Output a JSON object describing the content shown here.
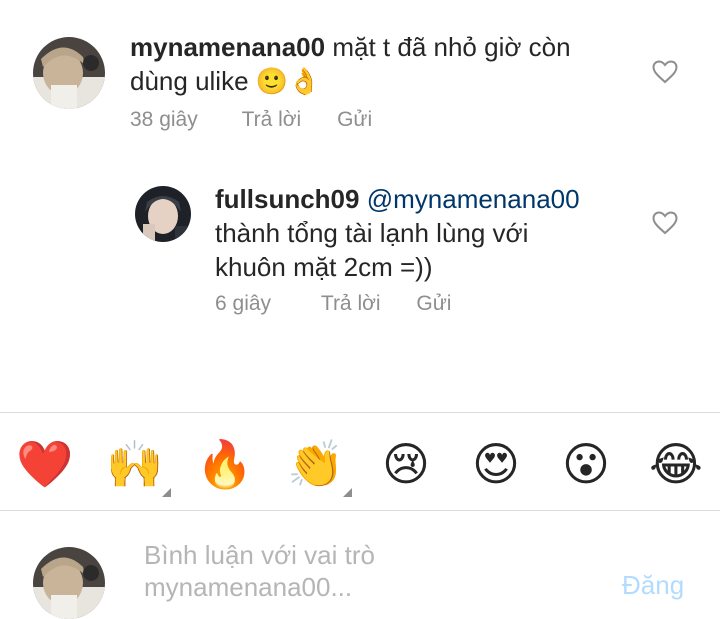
{
  "comments": [
    {
      "username": "mynamenana00",
      "text_line1": "mặt t đã nhỏ giờ còn",
      "text_line2": "dùng ulike",
      "emoji": "🙂👌",
      "time": "38 giây",
      "reply_label": "Trả lời",
      "send_label": "Gửi"
    },
    {
      "username": "fullsunch09",
      "mention": "@mynamenana00",
      "text_line1": "thành tổng tài lạnh lùng với",
      "text_line2": "khuôn mặt 2cm =))",
      "time": "6 giây",
      "reply_label": "Trả lời",
      "send_label": "Gửi"
    }
  ],
  "emoji_bar": [
    "❤️",
    "🙌",
    "🔥",
    "👏",
    "😢",
    "😍",
    "😮",
    "😂"
  ],
  "composer": {
    "placeholder_line1": "Bình luận với vai trò",
    "placeholder_line2": "mynamenana00...",
    "post_label": "Đăng"
  },
  "colors": {
    "text": "#262626",
    "secondary": "#8e8e8e",
    "mention": "#00376b",
    "post_disabled": "#b3dbff",
    "divider": "#dbdbdb"
  }
}
